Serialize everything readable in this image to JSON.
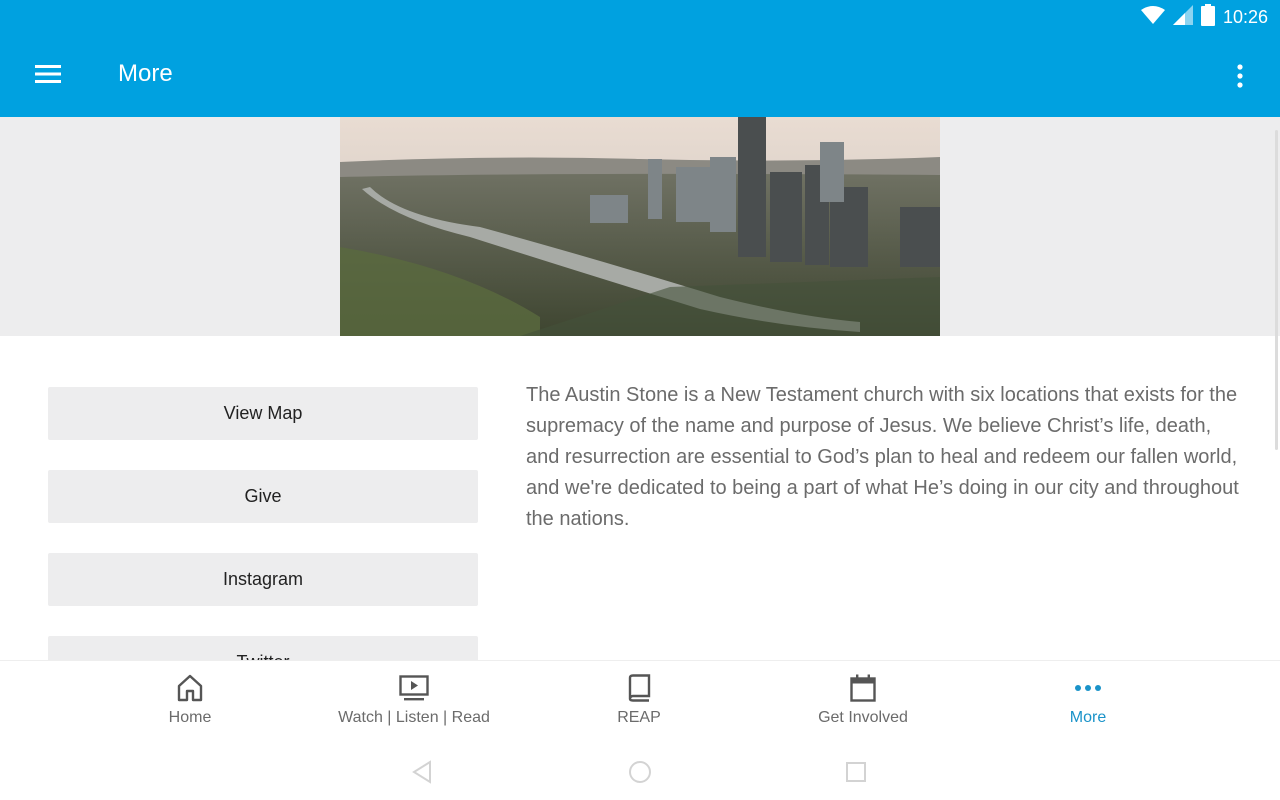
{
  "status": {
    "time": "10:26"
  },
  "header": {
    "title": "More"
  },
  "links": [
    {
      "label": "View Map"
    },
    {
      "label": "Give"
    },
    {
      "label": "Instagram"
    },
    {
      "label": "Twitter"
    }
  ],
  "about": {
    "text": "The Austin Stone is a New Testament church with six locations that exists for the supremacy of the name and purpose of Jesus. We believe Christ’s life, death, and resurrection are essential to God’s plan to heal and redeem our fallen world, and we're dedicated to being a part of what He’s doing in our city and throughout the nations."
  },
  "nav": {
    "items": [
      {
        "label": "Home",
        "icon": "home-icon"
      },
      {
        "label": "Watch | Listen | Read",
        "icon": "play-screen-icon"
      },
      {
        "label": "REAP",
        "icon": "book-icon"
      },
      {
        "label": "Get Involved",
        "icon": "calendar-icon"
      },
      {
        "label": "More",
        "icon": "more-dots-icon"
      }
    ],
    "active": "More"
  },
  "colors": {
    "accent": "#00a1e0",
    "active_nav": "#1a93c9",
    "button_bg": "#ededee"
  }
}
